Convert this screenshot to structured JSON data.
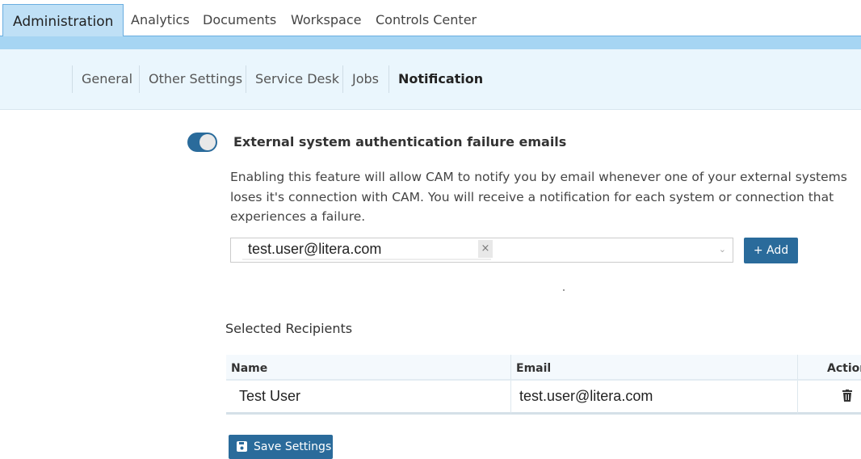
{
  "top_tabs": [
    {
      "label": "Administration",
      "active": true
    },
    {
      "label": "Analytics"
    },
    {
      "label": "Documents"
    },
    {
      "label": "Workspace"
    },
    {
      "label": "Controls Center"
    }
  ],
  "sub_nav": [
    {
      "label": "General"
    },
    {
      "label": "Other Settings"
    },
    {
      "label": "Service Desk"
    },
    {
      "label": "Jobs"
    },
    {
      "label": "Notification",
      "active": true
    }
  ],
  "feature": {
    "enabled": true,
    "title": "External system authentication failure emails",
    "description_lines": [
      "Enabling this feature will allow CAM to notify you by email whenever one of your external systems",
      "loses it's connection with CAM. You will receive a notification for each system or connection that",
      "experiences a failure."
    ]
  },
  "recipient_select": {
    "selected": "test.user@litera.com",
    "remove_icon": "×",
    "chevron_icon": "chevron-down"
  },
  "add_button": "+ Add",
  "recipients": {
    "title": "Selected Recipients",
    "columns": [
      "Name",
      "Email",
      "Action"
    ],
    "rows": [
      {
        "name": "Test User",
        "email": "test.user@litera.com",
        "action_icon": "trash-icon"
      }
    ]
  },
  "save_button": "Save Settings",
  "colors": {
    "accent": "#2a6b9b",
    "tab_active": "#bfe0f6",
    "subnav_bg": "#eaf6fd"
  }
}
